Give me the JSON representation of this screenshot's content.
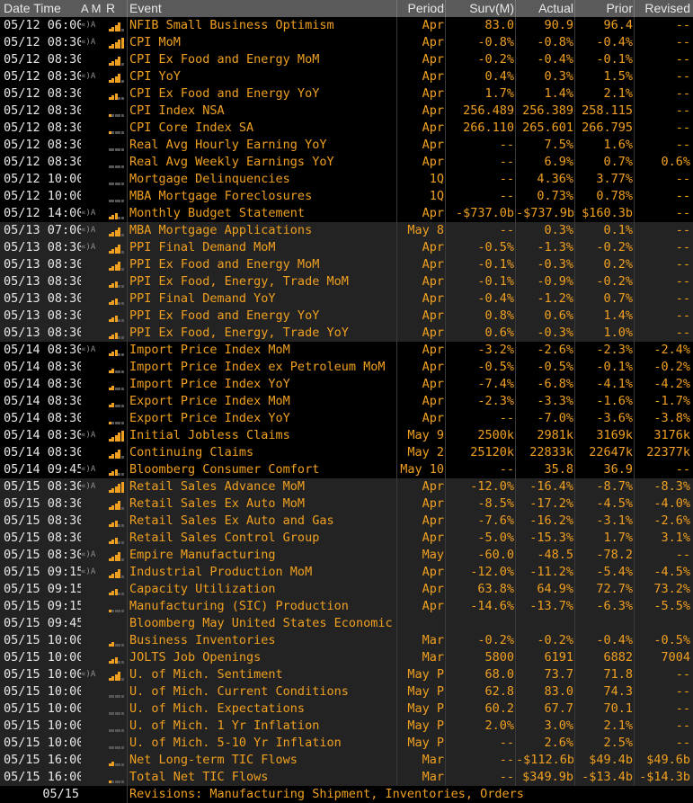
{
  "header": {
    "date_time": "Date Time",
    "am": "A M",
    "r": "R",
    "event": "Event",
    "period": "Period",
    "surv": "Surv(M)",
    "actual": "Actual",
    "prior": "Prior",
    "revised": "Revised"
  },
  "colors": {
    "accent": "#f0a020",
    "header_bg": "#5a5a5a",
    "alt_bg": "#232323",
    "text_white": "#e8e8e8"
  },
  "rows": [
    {
      "dt": "05/12 06:00",
      "am": "«)A",
      "r": 4,
      "event": "NFIB Small Business Optimism",
      "period": "Apr",
      "surv": "83.0",
      "actual": "90.9",
      "prior": "96.4",
      "rev": "--",
      "alt": false
    },
    {
      "dt": "05/12 08:30",
      "am": "«)A",
      "r": 5,
      "event": "CPI MoM",
      "period": "Apr",
      "surv": "-0.8%",
      "actual": "-0.8%",
      "prior": "-0.4%",
      "rev": "--",
      "alt": false
    },
    {
      "dt": "05/12 08:30",
      "am": "",
      "r": 4,
      "event": "CPI Ex Food and Energy MoM",
      "period": "Apr",
      "surv": "-0.2%",
      "actual": "-0.4%",
      "prior": "-0.1%",
      "rev": "--",
      "alt": false
    },
    {
      "dt": "05/12 08:30",
      "am": "«)A",
      "r": 4,
      "event": "CPI YoY",
      "period": "Apr",
      "surv": "0.4%",
      "actual": "0.3%",
      "prior": "1.5%",
      "rev": "--",
      "alt": false
    },
    {
      "dt": "05/12 08:30",
      "am": "",
      "r": 3,
      "event": "CPI Ex Food and Energy YoY",
      "period": "Apr",
      "surv": "1.7%",
      "actual": "1.4%",
      "prior": "2.1%",
      "rev": "--",
      "alt": false
    },
    {
      "dt": "05/12 08:30",
      "am": "",
      "r": 1,
      "event": "CPI Index NSA",
      "period": "Apr",
      "surv": "256.489",
      "actual": "256.389",
      "prior": "258.115",
      "rev": "--",
      "alt": false
    },
    {
      "dt": "05/12 08:30",
      "am": "",
      "r": 1,
      "event": "CPI Core Index SA",
      "period": "Apr",
      "surv": "266.110",
      "actual": "265.601",
      "prior": "266.795",
      "rev": "--",
      "alt": false
    },
    {
      "dt": "05/12 08:30",
      "am": "",
      "r": 0,
      "event": "Real Avg Hourly Earning YoY",
      "period": "Apr",
      "surv": "--",
      "actual": "7.5%",
      "prior": "1.6%",
      "rev": "--",
      "alt": false
    },
    {
      "dt": "05/12 08:30",
      "am": "",
      "r": 0,
      "event": "Real Avg Weekly Earnings YoY",
      "period": "Apr",
      "surv": "--",
      "actual": "6.9%",
      "prior": "0.7%",
      "rev": "0.6%",
      "alt": false
    },
    {
      "dt": "05/12 10:00",
      "am": "",
      "r": 0,
      "event": "Mortgage Delinquencies",
      "period": "1Q",
      "surv": "--",
      "actual": "4.36%",
      "prior": "3.77%",
      "rev": "--",
      "alt": false
    },
    {
      "dt": "05/12 10:00",
      "am": "",
      "r": 0,
      "event": "MBA Mortgage Foreclosures",
      "period": "1Q",
      "surv": "--",
      "actual": "0.73%",
      "prior": "0.78%",
      "rev": "--",
      "alt": false
    },
    {
      "dt": "05/12 14:00",
      "am": "«)A",
      "r": 3,
      "event": "Monthly Budget Statement",
      "period": "Apr",
      "surv": "-$737.0b",
      "actual": "-$737.9b",
      "prior": "$160.3b",
      "rev": "--",
      "alt": false
    },
    {
      "dt": "05/13 07:00",
      "am": "«)A",
      "r": 4,
      "event": "MBA Mortgage Applications",
      "period": "May 8",
      "surv": "--",
      "actual": "0.3%",
      "prior": "0.1%",
      "rev": "--",
      "alt": true
    },
    {
      "dt": "05/13 08:30",
      "am": "«)A",
      "r": 4,
      "event": "PPI Final Demand MoM",
      "period": "Apr",
      "surv": "-0.5%",
      "actual": "-1.3%",
      "prior": "-0.2%",
      "rev": "--",
      "alt": true
    },
    {
      "dt": "05/13 08:30",
      "am": "",
      "r": 4,
      "event": "PPI Ex Food and Energy MoM",
      "period": "Apr",
      "surv": "-0.1%",
      "actual": "-0.3%",
      "prior": "0.2%",
      "rev": "--",
      "alt": true
    },
    {
      "dt": "05/13 08:30",
      "am": "",
      "r": 3,
      "event": "PPI Ex Food, Energy, Trade MoM",
      "period": "Apr",
      "surv": "-0.1%",
      "actual": "-0.9%",
      "prior": "-0.2%",
      "rev": "--",
      "alt": true
    },
    {
      "dt": "05/13 08:30",
      "am": "",
      "r": 3,
      "event": "PPI Final Demand YoY",
      "period": "Apr",
      "surv": "-0.4%",
      "actual": "-1.2%",
      "prior": "0.7%",
      "rev": "--",
      "alt": true
    },
    {
      "dt": "05/13 08:30",
      "am": "",
      "r": 3,
      "event": "PPI Ex Food and Energy YoY",
      "period": "Apr",
      "surv": "0.8%",
      "actual": "0.6%",
      "prior": "1.4%",
      "rev": "--",
      "alt": true
    },
    {
      "dt": "05/13 08:30",
      "am": "",
      "r": 3,
      "event": "PPI Ex Food, Energy, Trade YoY",
      "period": "Apr",
      "surv": "0.6%",
      "actual": "-0.3%",
      "prior": "1.0%",
      "rev": "--",
      "alt": true
    },
    {
      "dt": "05/14 08:30",
      "am": "«)A",
      "r": 3,
      "event": "Import Price Index MoM",
      "period": "Apr",
      "surv": "-3.2%",
      "actual": "-2.6%",
      "prior": "-2.3%",
      "rev": "-2.4%",
      "alt": false
    },
    {
      "dt": "05/14 08:30",
      "am": "",
      "r": 2,
      "event": "Import Price Index ex Petroleum MoM",
      "period": "Apr",
      "surv": "-0.5%",
      "actual": "-0.5%",
      "prior": "-0.1%",
      "rev": "-0.2%",
      "alt": false
    },
    {
      "dt": "05/14 08:30",
      "am": "",
      "r": 2,
      "event": "Import Price Index YoY",
      "period": "Apr",
      "surv": "-7.4%",
      "actual": "-6.8%",
      "prior": "-4.1%",
      "rev": "-4.2%",
      "alt": false
    },
    {
      "dt": "05/14 08:30",
      "am": "",
      "r": 2,
      "event": "Export Price Index MoM",
      "period": "Apr",
      "surv": "-2.3%",
      "actual": "-3.3%",
      "prior": "-1.6%",
      "rev": "-1.7%",
      "alt": false
    },
    {
      "dt": "05/14 08:30",
      "am": "",
      "r": 1,
      "event": "Export Price Index YoY",
      "period": "Apr",
      "surv": "--",
      "actual": "-7.0%",
      "prior": "-3.6%",
      "rev": "-3.8%",
      "alt": false
    },
    {
      "dt": "05/14 08:30",
      "am": "«)A",
      "r": 5,
      "event": "Initial Jobless Claims",
      "period": "May 9",
      "surv": "2500k",
      "actual": "2981k",
      "prior": "3169k",
      "rev": "3176k",
      "alt": false
    },
    {
      "dt": "05/14 08:30",
      "am": "",
      "r": 4,
      "event": "Continuing Claims",
      "period": "May 2",
      "surv": "25120k",
      "actual": "22833k",
      "prior": "22647k",
      "rev": "22377k",
      "alt": false
    },
    {
      "dt": "05/14 09:45",
      "am": "«)A",
      "r": 3,
      "event": "Bloomberg Consumer Comfort",
      "period": "May 10",
      "surv": "--",
      "actual": "35.8",
      "prior": "36.9",
      "rev": "--",
      "alt": false
    },
    {
      "dt": "05/15 08:30",
      "am": "«)A",
      "r": 5,
      "event": "Retail Sales Advance MoM",
      "period": "Apr",
      "surv": "-12.0%",
      "actual": "-16.4%",
      "prior": "-8.7%",
      "rev": "-8.3%",
      "alt": true
    },
    {
      "dt": "05/15 08:30",
      "am": "",
      "r": 4,
      "event": "Retail Sales Ex Auto MoM",
      "period": "Apr",
      "surv": "-8.5%",
      "actual": "-17.2%",
      "prior": "-4.5%",
      "rev": "-4.0%",
      "alt": true
    },
    {
      "dt": "05/15 08:30",
      "am": "",
      "r": 3,
      "event": "Retail Sales Ex Auto and Gas",
      "period": "Apr",
      "surv": "-7.6%",
      "actual": "-16.2%",
      "prior": "-3.1%",
      "rev": "-2.6%",
      "alt": true
    },
    {
      "dt": "05/15 08:30",
      "am": "",
      "r": 3,
      "event": "Retail Sales Control Group",
      "period": "Apr",
      "surv": "-5.0%",
      "actual": "-15.3%",
      "prior": "1.7%",
      "rev": "3.1%",
      "alt": true
    },
    {
      "dt": "05/15 08:30",
      "am": "«)A",
      "r": 4,
      "event": "Empire Manufacturing",
      "period": "May",
      "surv": "-60.0",
      "actual": "-48.5",
      "prior": "-78.2",
      "rev": "--",
      "alt": true
    },
    {
      "dt": "05/15 09:15",
      "am": "«)A",
      "r": 4,
      "event": "Industrial Production MoM",
      "period": "Apr",
      "surv": "-12.0%",
      "actual": "-11.2%",
      "prior": "-5.4%",
      "rev": "-4.5%",
      "alt": true
    },
    {
      "dt": "05/15 09:15",
      "am": "",
      "r": 3,
      "event": "Capacity Utilization",
      "period": "Apr",
      "surv": "63.8%",
      "actual": "64.9%",
      "prior": "72.7%",
      "rev": "73.2%",
      "alt": true
    },
    {
      "dt": "05/15 09:15",
      "am": "",
      "r": 1,
      "event": "Manufacturing (SIC) Production",
      "period": "Apr",
      "surv": "-14.6%",
      "actual": "-13.7%",
      "prior": "-6.3%",
      "rev": "-5.5%",
      "alt": true
    },
    {
      "dt": "05/15 09:45",
      "am": "",
      "r": -1,
      "event": "Bloomberg May United States Economic Survey",
      "period": "",
      "surv": "",
      "actual": "",
      "prior": "",
      "rev": "",
      "alt": true
    },
    {
      "dt": "05/15 10:00",
      "am": "",
      "r": 2,
      "event": "Business Inventories",
      "period": "Mar",
      "surv": "-0.2%",
      "actual": "-0.2%",
      "prior": "-0.4%",
      "rev": "-0.5%",
      "alt": true
    },
    {
      "dt": "05/15 10:00",
      "am": "",
      "r": 3,
      "event": "JOLTS Job Openings",
      "period": "Mar",
      "surv": "5800",
      "actual": "6191",
      "prior": "6882",
      "rev": "7004",
      "alt": true
    },
    {
      "dt": "05/15 10:00",
      "am": "«)A",
      "r": 4,
      "event": "U. of Mich. Sentiment",
      "period": "May P",
      "surv": "68.0",
      "actual": "73.7",
      "prior": "71.8",
      "rev": "--",
      "alt": true
    },
    {
      "dt": "05/15 10:00",
      "am": "",
      "r": 0,
      "event": "U. of Mich. Current Conditions",
      "period": "May P",
      "surv": "62.8",
      "actual": "83.0",
      "prior": "74.3",
      "rev": "--",
      "alt": true
    },
    {
      "dt": "05/15 10:00",
      "am": "",
      "r": 0,
      "event": "U. of Mich. Expectations",
      "period": "May P",
      "surv": "60.2",
      "actual": "67.7",
      "prior": "70.1",
      "rev": "--",
      "alt": true
    },
    {
      "dt": "05/15 10:00",
      "am": "",
      "r": 0,
      "event": "U. of Mich. 1 Yr Inflation",
      "period": "May P",
      "surv": "2.0%",
      "actual": "3.0%",
      "prior": "2.1%",
      "rev": "--",
      "alt": true
    },
    {
      "dt": "05/15 10:00",
      "am": "",
      "r": 0,
      "event": "U. of Mich. 5-10 Yr Inflation",
      "period": "May P",
      "surv": "--",
      "actual": "2.6%",
      "prior": "2.5%",
      "rev": "--",
      "alt": true
    },
    {
      "dt": "05/15 16:00",
      "am": "",
      "r": 2,
      "event": "Net Long-term TIC Flows",
      "period": "Mar",
      "surv": "--",
      "actual": "-$112.6b",
      "prior": "$49.4b",
      "rev": "$49.6b",
      "alt": true
    },
    {
      "dt": "05/15 16:00",
      "am": "",
      "r": 1,
      "event": "Total Net TIC Flows",
      "period": "Mar",
      "surv": "--",
      "actual": "$349.9b",
      "prior": "-$13.4b",
      "rev": "-$14.3b",
      "alt": true
    },
    {
      "dt": "05/15",
      "am": "",
      "r": -1,
      "event": "Revisions: Manufacturing Shipment, Inventories, Orders",
      "period": "",
      "surv": "",
      "actual": "",
      "prior": "",
      "rev": "",
      "alt": false,
      "note": true
    }
  ]
}
